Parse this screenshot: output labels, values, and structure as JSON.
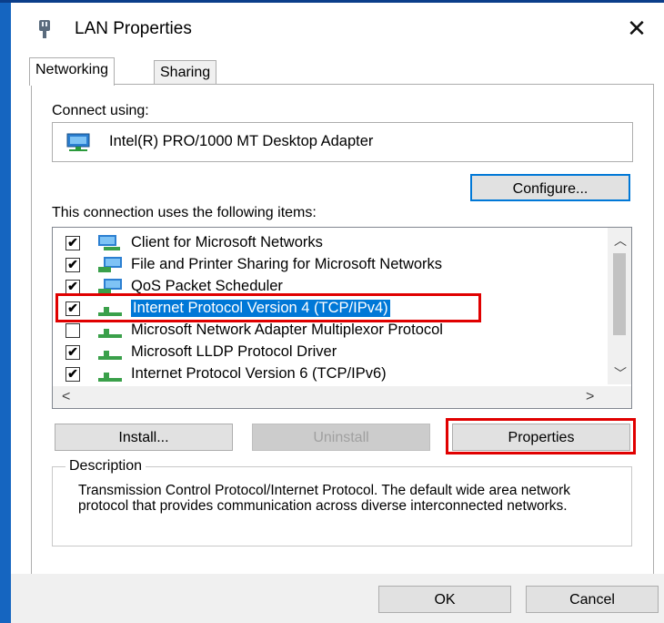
{
  "window": {
    "title": "LAN Properties",
    "close_symbol": "✕"
  },
  "tabs": [
    {
      "label": "Networking"
    },
    {
      "label": "Sharing"
    }
  ],
  "connect_using": {
    "label": "Connect using:",
    "adapter": "Intel(R) PRO/1000 MT Desktop Adapter"
  },
  "configure_button": "Configure...",
  "items_label": "This connection uses the following items:",
  "items": [
    {
      "label": "Client for Microsoft Networks",
      "checked": true,
      "icon": "network-client-icon"
    },
    {
      "label": "File and Printer Sharing for Microsoft Networks",
      "checked": true,
      "icon": "network-service-icon"
    },
    {
      "label": "QoS Packet Scheduler",
      "checked": true,
      "icon": "network-service-icon"
    },
    {
      "label": "Internet Protocol Version 4 (TCP/IPv4)",
      "checked": true,
      "icon": "protocol-icon",
      "selected": true
    },
    {
      "label": "Microsoft Network Adapter Multiplexor Protocol",
      "checked": false,
      "icon": "protocol-icon"
    },
    {
      "label": "Microsoft LLDP Protocol Driver",
      "checked": true,
      "icon": "protocol-icon"
    },
    {
      "label": "Internet Protocol Version 6 (TCP/IPv6)",
      "checked": true,
      "icon": "protocol-icon"
    }
  ],
  "buttons": {
    "install": "Install...",
    "uninstall": "Uninstall",
    "properties": "Properties",
    "ok": "OK",
    "cancel": "Cancel"
  },
  "description": {
    "legend": "Description",
    "text": "Transmission Control Protocol/Internet Protocol. The default wide area network protocol that provides communication across diverse interconnected networks."
  },
  "colors": {
    "accent": "#0078d7",
    "highlight": "#e00000",
    "frame": "#1565c0"
  }
}
